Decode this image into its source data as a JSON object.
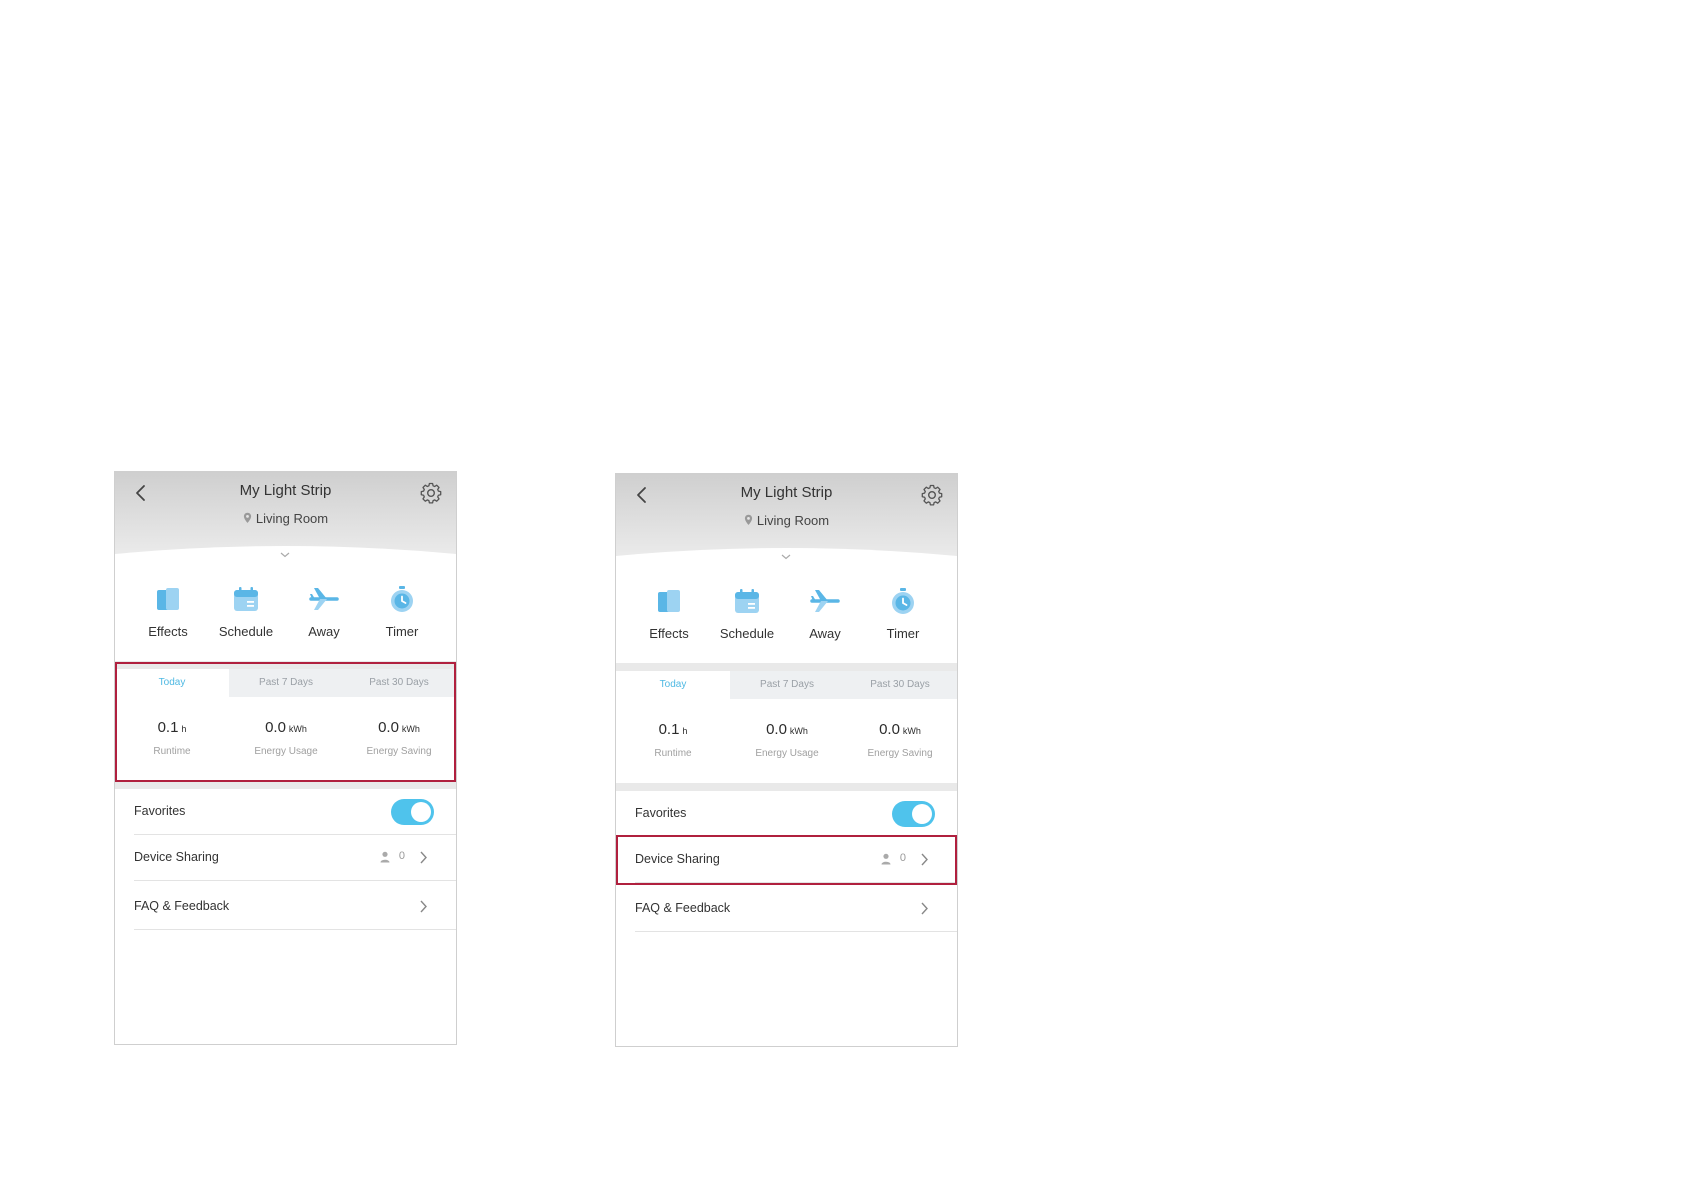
{
  "device": {
    "title": "My Light Strip",
    "location": "Living Room"
  },
  "shortcuts": [
    {
      "label": "Effects",
      "icon": "effects-icon"
    },
    {
      "label": "Schedule",
      "icon": "calendar-icon"
    },
    {
      "label": "Away",
      "icon": "airplane-icon"
    },
    {
      "label": "Timer",
      "icon": "stopwatch-icon"
    }
  ],
  "usage": {
    "tabs": [
      "Today",
      "Past 7 Days",
      "Past 30 Days"
    ],
    "active_tab": "Today",
    "stats": [
      {
        "value": "0.1",
        "unit": "h",
        "caption": "Runtime"
      },
      {
        "value": "0.0",
        "unit": "kWh",
        "caption": "Energy Usage"
      },
      {
        "value": "0.0",
        "unit": "kWh",
        "caption": "Energy Saving"
      }
    ]
  },
  "settings": {
    "favorites_label": "Favorites",
    "favorites_on": true,
    "sharing_label": "Device Sharing",
    "sharing_count": "0",
    "faq_label": "FAQ & Feedback"
  },
  "colors": {
    "accent": "#4fc3ec",
    "icon_blue": "#5ab6e6",
    "highlight": "#b0203e"
  }
}
